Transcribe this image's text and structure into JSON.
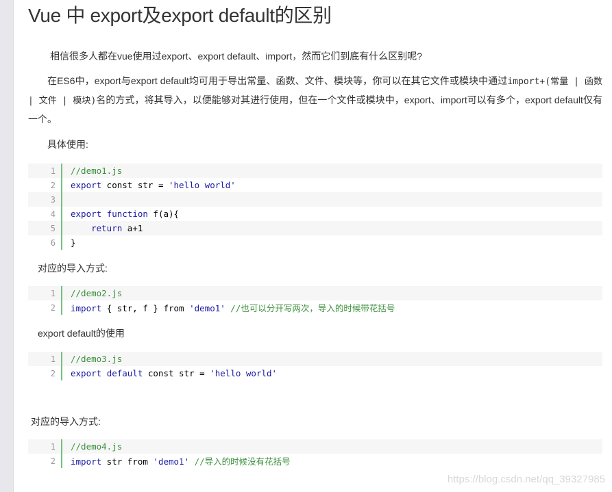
{
  "article": {
    "title": "Vue 中 export及export default的区别",
    "intro": "相信很多人都在vue使用过export、export default、import，然而它们到底有什么区别呢?",
    "para2_a": "在ES6中，export与export default均可用于导出常量、函数、文件、模块等，你可以在其它文件或模块中通过",
    "para2_code": "import+(常量 | 函数 | 文件 | 模块)",
    "para2_b": "名的方式，将其导入，以便能够对其进行使用，但在一个文件或模块中，export、import可以有多个，export default仅有一个。",
    "label1": "具体使用:",
    "label2": "对应的导入方式:",
    "label3": "export default的使用",
    "label4": "对应的导入方式:"
  },
  "code1": [
    {
      "n": "1",
      "tokens": [
        {
          "t": "//demo1.js",
          "c": "comment"
        }
      ]
    },
    {
      "n": "2",
      "tokens": [
        {
          "t": "export",
          "c": "kw"
        },
        {
          "t": " const str = "
        },
        {
          "t": "'hello world'",
          "c": "str"
        }
      ]
    },
    {
      "n": "3",
      "tokens": []
    },
    {
      "n": "4",
      "tokens": [
        {
          "t": "export",
          "c": "kw"
        },
        {
          "t": " "
        },
        {
          "t": "function",
          "c": "kw"
        },
        {
          "t": " f(a){"
        }
      ]
    },
    {
      "n": "5",
      "tokens": [
        {
          "t": "    "
        },
        {
          "t": "return",
          "c": "kw"
        },
        {
          "t": " a+1"
        }
      ]
    },
    {
      "n": "6",
      "tokens": [
        {
          "t": "}"
        }
      ]
    }
  ],
  "code2": [
    {
      "n": "1",
      "tokens": [
        {
          "t": "//demo2.js",
          "c": "comment"
        }
      ]
    },
    {
      "n": "2",
      "tokens": [
        {
          "t": "import",
          "c": "kw"
        },
        {
          "t": " { str, f } from "
        },
        {
          "t": "'demo1'",
          "c": "str"
        },
        {
          "t": " //也可以分开写两次，导入的时候带花括号",
          "c": "comment"
        }
      ]
    }
  ],
  "code3": [
    {
      "n": "1",
      "tokens": [
        {
          "t": "//demo3.js",
          "c": "comment"
        }
      ]
    },
    {
      "n": "2",
      "tokens": [
        {
          "t": "export",
          "c": "kw"
        },
        {
          "t": " "
        },
        {
          "t": "default",
          "c": "kw"
        },
        {
          "t": " const str = "
        },
        {
          "t": "'hello world'",
          "c": "str"
        }
      ]
    }
  ],
  "code4": [
    {
      "n": "1",
      "tokens": [
        {
          "t": "//demo4.js",
          "c": "comment"
        }
      ]
    },
    {
      "n": "2",
      "tokens": [
        {
          "t": "import",
          "c": "kw"
        },
        {
          "t": " str from "
        },
        {
          "t": "'demo1'",
          "c": "str"
        },
        {
          "t": " //导入的时候没有花括号",
          "c": "comment"
        }
      ]
    }
  ],
  "watermark": "https://blog.csdn.net/qq_39327985",
  "colors": {
    "gutter": "#72c47b",
    "keyword": "#1a1aa6",
    "comment": "#3c8f3c"
  }
}
